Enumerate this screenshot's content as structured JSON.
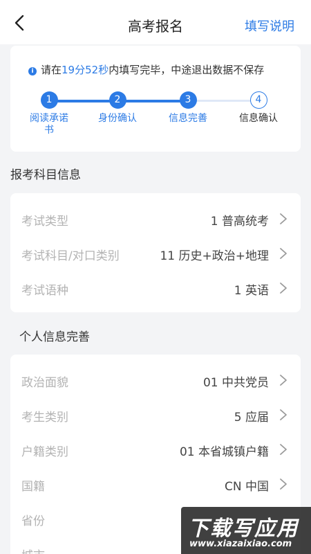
{
  "header": {
    "title": "高考报名",
    "help_label": "填写说明",
    "back_icon": "chevron-left-icon"
  },
  "notice": {
    "prefix": "请在",
    "time": "19分52秒",
    "suffix": "内填写完毕，中途退出数据不保存",
    "icon": "info-icon"
  },
  "steps": [
    {
      "number": "1",
      "label": "阅读承诺书",
      "status": "done"
    },
    {
      "number": "2",
      "label": "身份确认",
      "status": "done"
    },
    {
      "number": "3",
      "label": "信息完善",
      "status": "done"
    },
    {
      "number": "4",
      "label": "信息确认",
      "status": "current"
    }
  ],
  "exam_section": {
    "title": "报考科目信息",
    "rows": [
      {
        "label": "考试类型",
        "value": "1 普高统考"
      },
      {
        "label": "考试科目/对口类别",
        "value": "11 历史+政治+地理"
      },
      {
        "label": "考试语种",
        "value": "1 英语"
      }
    ]
  },
  "personal_section": {
    "title": "个人信息完善",
    "rows": [
      {
        "label": "政治面貌",
        "value": "01 中共党员"
      },
      {
        "label": "考生类别",
        "value": "5 应届"
      },
      {
        "label": "户籍类别",
        "value": "01 本省城镇户籍"
      },
      {
        "label": "国籍",
        "value": "CN 中国"
      },
      {
        "label": "省份",
        "value": ""
      },
      {
        "label": "城市",
        "value": ""
      }
    ]
  },
  "watermark": {
    "title": "下载写应用",
    "url": "www.xiazaixiao.com"
  },
  "colors": {
    "accent": "#2c7be5",
    "background": "#f3f4f6",
    "label_gray": "#b3b3b3"
  }
}
